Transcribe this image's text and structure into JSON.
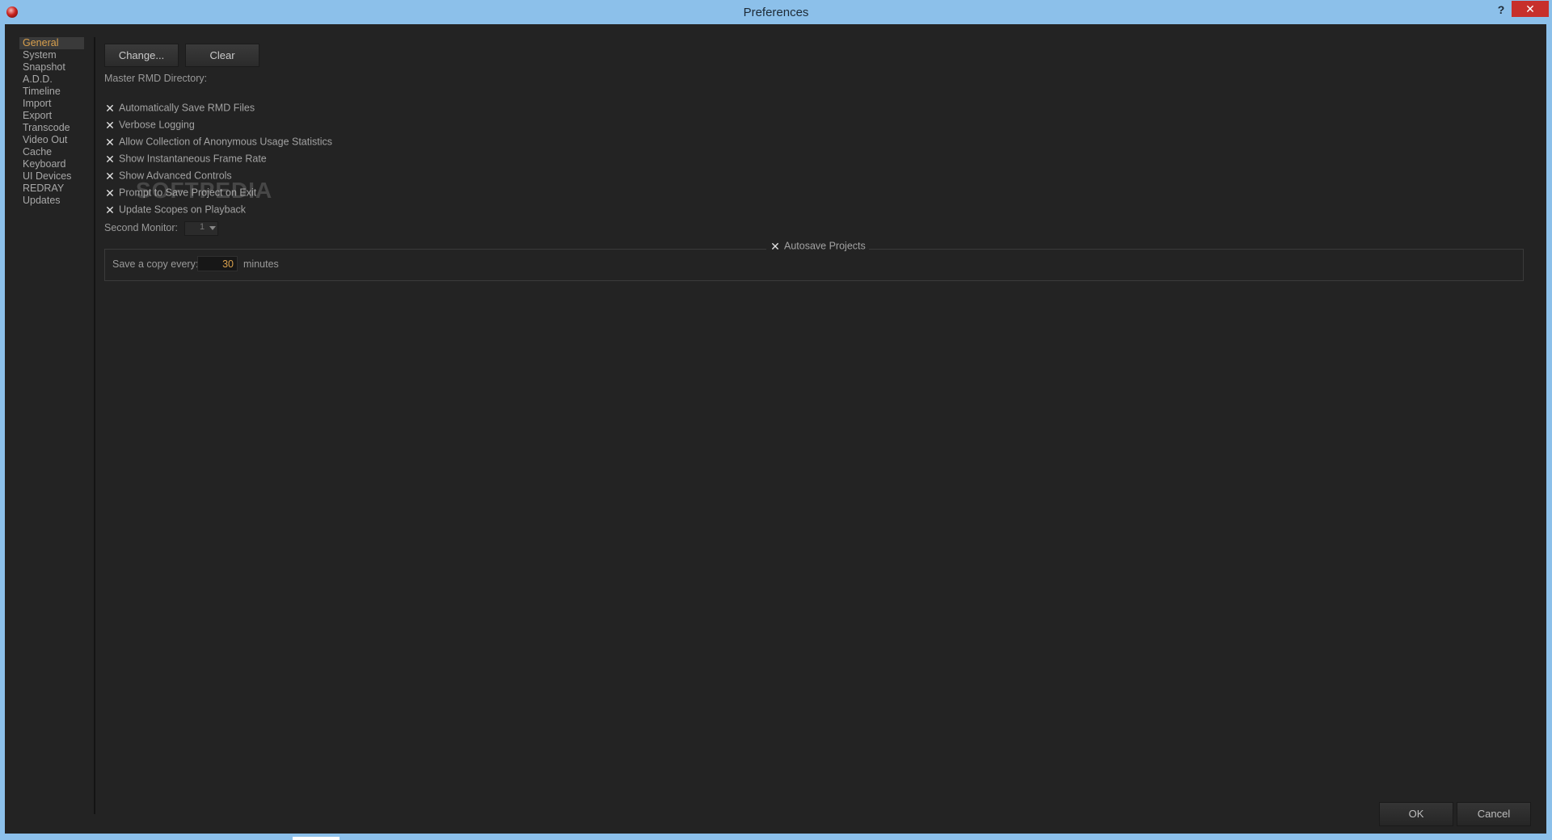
{
  "window": {
    "title": "Preferences",
    "help_label": "?",
    "close_label": "✕",
    "colors": {
      "titlebar": "#8cc0ea",
      "close": "#c7302b",
      "background": "#232323",
      "accent": "#d9a04d"
    }
  },
  "sidebar": {
    "items": [
      {
        "label": "General",
        "active": true
      },
      {
        "label": "System"
      },
      {
        "label": "Snapshot"
      },
      {
        "label": "A.D.D."
      },
      {
        "label": "Timeline"
      },
      {
        "label": "Import"
      },
      {
        "label": "Export"
      },
      {
        "label": "Transcode"
      },
      {
        "label": "Video Out"
      },
      {
        "label": "Cache"
      },
      {
        "label": "Keyboard"
      },
      {
        "label": "UI Devices"
      },
      {
        "label": "REDRAY"
      },
      {
        "label": "Updates"
      }
    ]
  },
  "general": {
    "change_button": "Change...",
    "clear_button": "Clear",
    "master_rmd_label": "Master RMD Directory:",
    "checkboxes": {
      "auto_save_rmd": {
        "label": "Automatically Save RMD Files",
        "checked": true
      },
      "verbose_logging": {
        "label": "Verbose Logging",
        "checked": true
      },
      "anon_stats": {
        "label": "Allow Collection of Anonymous Usage Statistics",
        "checked": true
      },
      "instant_frame_rate": {
        "label": "Show Instantaneous Frame Rate",
        "checked": true
      },
      "advanced_controls": {
        "label": "Show Advanced Controls",
        "checked": true
      },
      "prompt_save": {
        "label": "Prompt to Save Project on Exit",
        "checked": true
      },
      "update_scopes": {
        "label": "Update Scopes on Playback",
        "checked": true
      }
    },
    "check_mark": "✕",
    "second_monitor_label": "Second Monitor:",
    "second_monitor_value": "1",
    "autosave": {
      "legend": "Autosave Projects",
      "checked": true,
      "save_copy_label": "Save a copy every:",
      "interval": "30",
      "unit": "minutes"
    }
  },
  "watermark": "SOFTPEDIA",
  "footer": {
    "ok_button": "OK",
    "cancel_button": "Cancel"
  }
}
